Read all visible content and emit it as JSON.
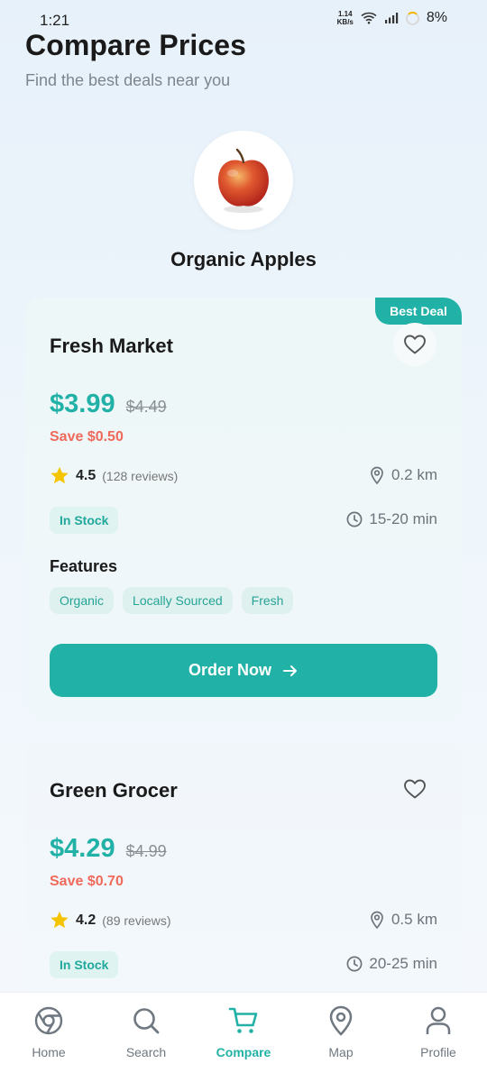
{
  "status_bar": {
    "time": "1:21",
    "net_speed_value": "1.14",
    "net_speed_unit": "KB/s",
    "battery": "8%"
  },
  "header": {
    "title": "Compare Prices",
    "subtitle": "Find the best deals near you"
  },
  "product": {
    "name": "Organic Apples"
  },
  "stores": [
    {
      "badge": "Best Deal",
      "name": "Fresh Market",
      "price": "$3.99",
      "old_price": "$4.49",
      "save": "Save $0.50",
      "rating": "4.5",
      "reviews": "(128 reviews)",
      "distance": "0.2 km",
      "stock": "In Stock",
      "delivery": "15-20 min",
      "features_title": "Features",
      "features": [
        "Organic",
        "Locally Sourced",
        "Fresh"
      ],
      "order_label": "Order Now"
    },
    {
      "name": "Green Grocer",
      "price": "$4.29",
      "old_price": "$4.99",
      "save": "Save $0.70",
      "rating": "4.2",
      "reviews": "(89 reviews)",
      "distance": "0.5 km",
      "stock": "In Stock",
      "delivery": "20-25 min"
    }
  ],
  "nav": {
    "items": [
      {
        "label": "Home",
        "icon": "home-icon"
      },
      {
        "label": "Search",
        "icon": "search-icon"
      },
      {
        "label": "Compare",
        "icon": "cart-icon",
        "active": true
      },
      {
        "label": "Map",
        "icon": "map-pin-icon"
      },
      {
        "label": "Profile",
        "icon": "profile-icon"
      }
    ]
  },
  "colors": {
    "accent": "#22b1a6",
    "save": "#ef6a5b",
    "star": "#f5c400"
  }
}
